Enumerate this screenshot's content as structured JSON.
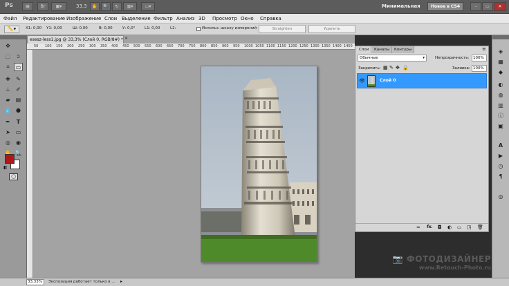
{
  "appbar": {
    "logo": "Ps",
    "zoom": "33,3",
    "workspace": "Минимальная",
    "whats_new": "Новое в CS4"
  },
  "menu": [
    "Файл",
    "Редактирование",
    "Изображение",
    "Слои",
    "Выделение",
    "Фильтр",
    "Анализ",
    "3D",
    "Просмотр",
    "Окно",
    "Справка"
  ],
  "options": {
    "x1_label": "X1: 0,00",
    "y1_label": "Y1: 0,00",
    "w_label": "Ш: 0,00",
    "h_label": "В: 0,00",
    "angle_label": "У: 0,0°",
    "l1_label": "L1: 0,00",
    "l2_label": "L2:",
    "checkbox_label": "Использ. шкалу измерений",
    "straighten": "Straighten",
    "clear": "Удалить"
  },
  "document": {
    "tab_title": "esesz-less1.jpg @ 33,3% (Слой 0, RGB/8#) *",
    "ruler_top": [
      "50",
      "100",
      "150",
      "200",
      "250",
      "300",
      "350",
      "400",
      "450",
      "500",
      "550",
      "600",
      "650",
      "700",
      "750",
      "800",
      "850",
      "900",
      "950",
      "1000",
      "1050",
      "1100",
      "1150",
      "1200",
      "1250",
      "1300",
      "1350",
      "1400",
      "1450"
    ]
  },
  "layers_panel": {
    "tabs": [
      "Слои",
      "Каналы",
      "Контуры"
    ],
    "blend_mode": "Обычные",
    "opacity_label": "Непрозрачность:",
    "opacity_value": "100%",
    "lock_label": "Закрепить:",
    "fill_label": "Заливка:",
    "fill_value": "100%",
    "layer_name": "Слой 0"
  },
  "status": {
    "zoom": "33,33%",
    "message": "Экспозиция работает только в ..."
  },
  "watermark": {
    "line1": "ФОТОДИЗАЙНЕР",
    "line2": "www.Retouch-Photo.ru"
  },
  "colors": {
    "foreground": "#b01818",
    "background": "#ffffff",
    "selection": "#3399ff"
  }
}
